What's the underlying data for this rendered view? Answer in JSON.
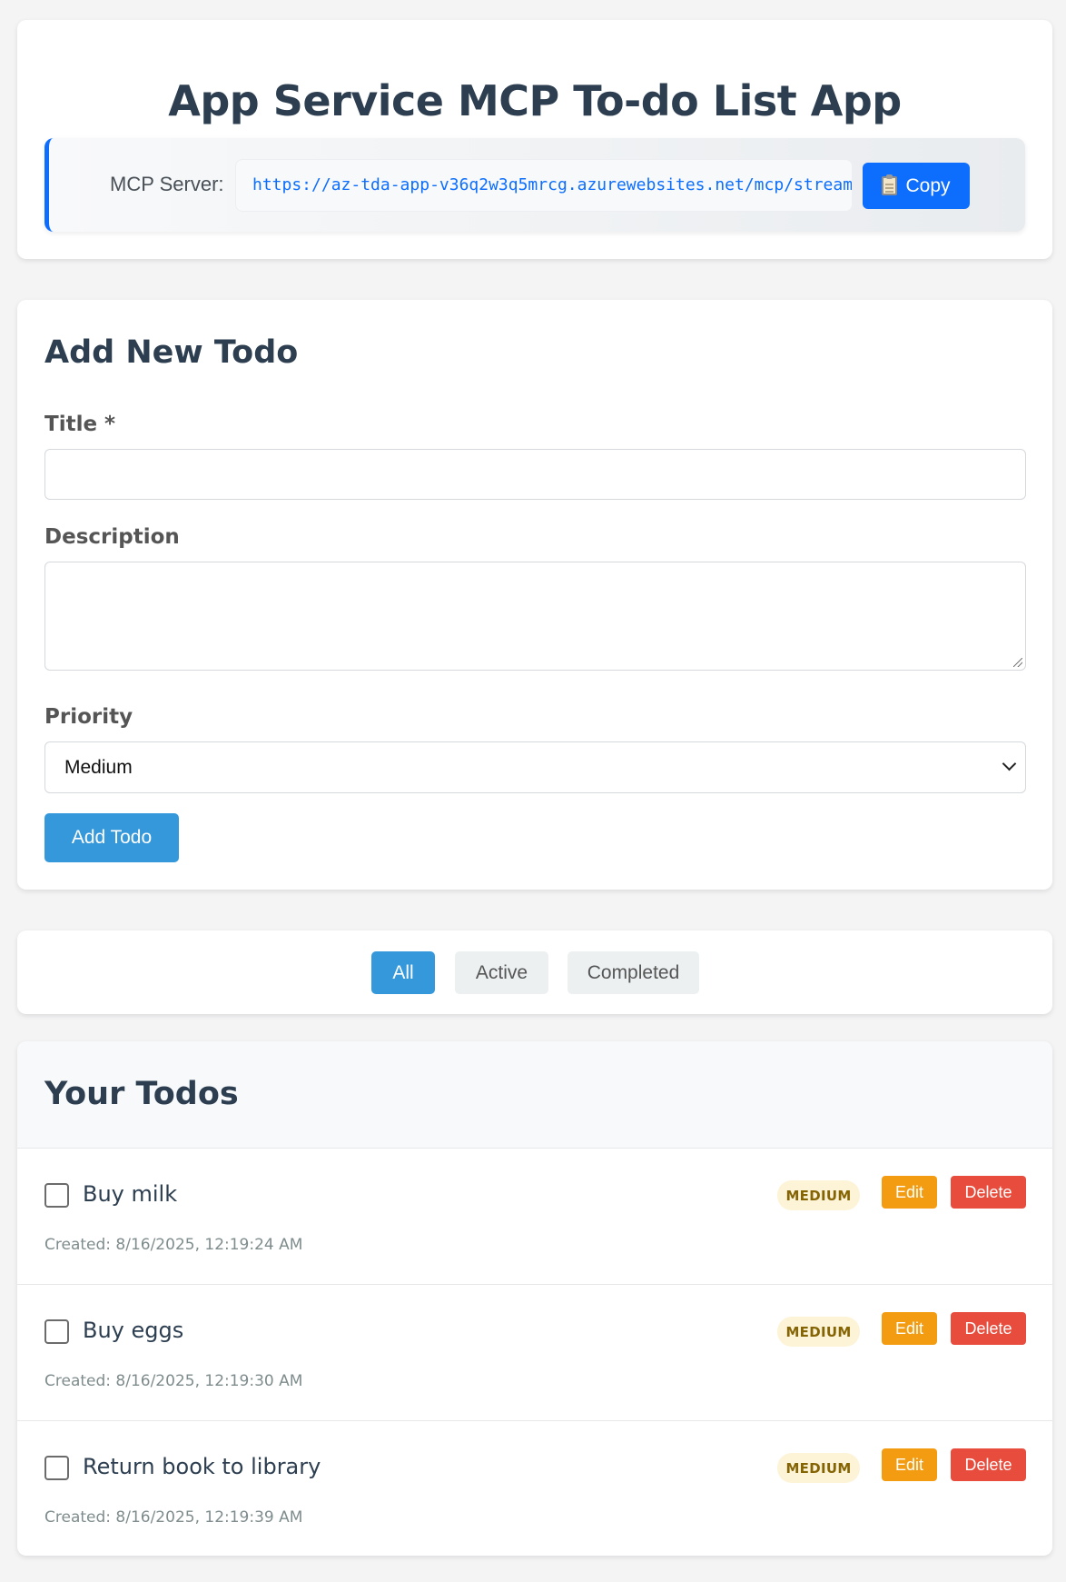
{
  "header": {
    "title": "App Service MCP To-do List App",
    "mcp_label": "MCP Server:",
    "mcp_url": "https://az-tda-app-v36q2w3q5mrcg.azurewebsites.net/mcp/stream",
    "copy_label": "Copy",
    "copy_icon": "clipboard-icon"
  },
  "form": {
    "heading": "Add New Todo",
    "title_label": "Title *",
    "title_value": "",
    "description_label": "Description",
    "description_value": "",
    "priority_label": "Priority",
    "priority_value": "Medium",
    "submit_label": "Add Todo"
  },
  "filters": {
    "items": [
      "All",
      "Active",
      "Completed"
    ],
    "active": "All"
  },
  "todos": {
    "heading": "Your Todos",
    "edit_label": "Edit",
    "delete_label": "Delete",
    "items": [
      {
        "title": "Buy milk",
        "priority": "MEDIUM",
        "created": "Created: 8/16/2025, 12:19:24 AM",
        "completed": false
      },
      {
        "title": "Buy eggs",
        "priority": "MEDIUM",
        "created": "Created: 8/16/2025, 12:19:30 AM",
        "completed": false
      },
      {
        "title": "Return book to library",
        "priority": "MEDIUM",
        "created": "Created: 8/16/2025, 12:19:39 AM",
        "completed": false
      }
    ]
  },
  "colors": {
    "primary": "#3498db",
    "mcp_accent": "#0d6efd",
    "edit": "#f39c12",
    "delete": "#e74c3c",
    "badge_medium_bg": "#fdf3d7",
    "heading": "#2c3e50"
  }
}
